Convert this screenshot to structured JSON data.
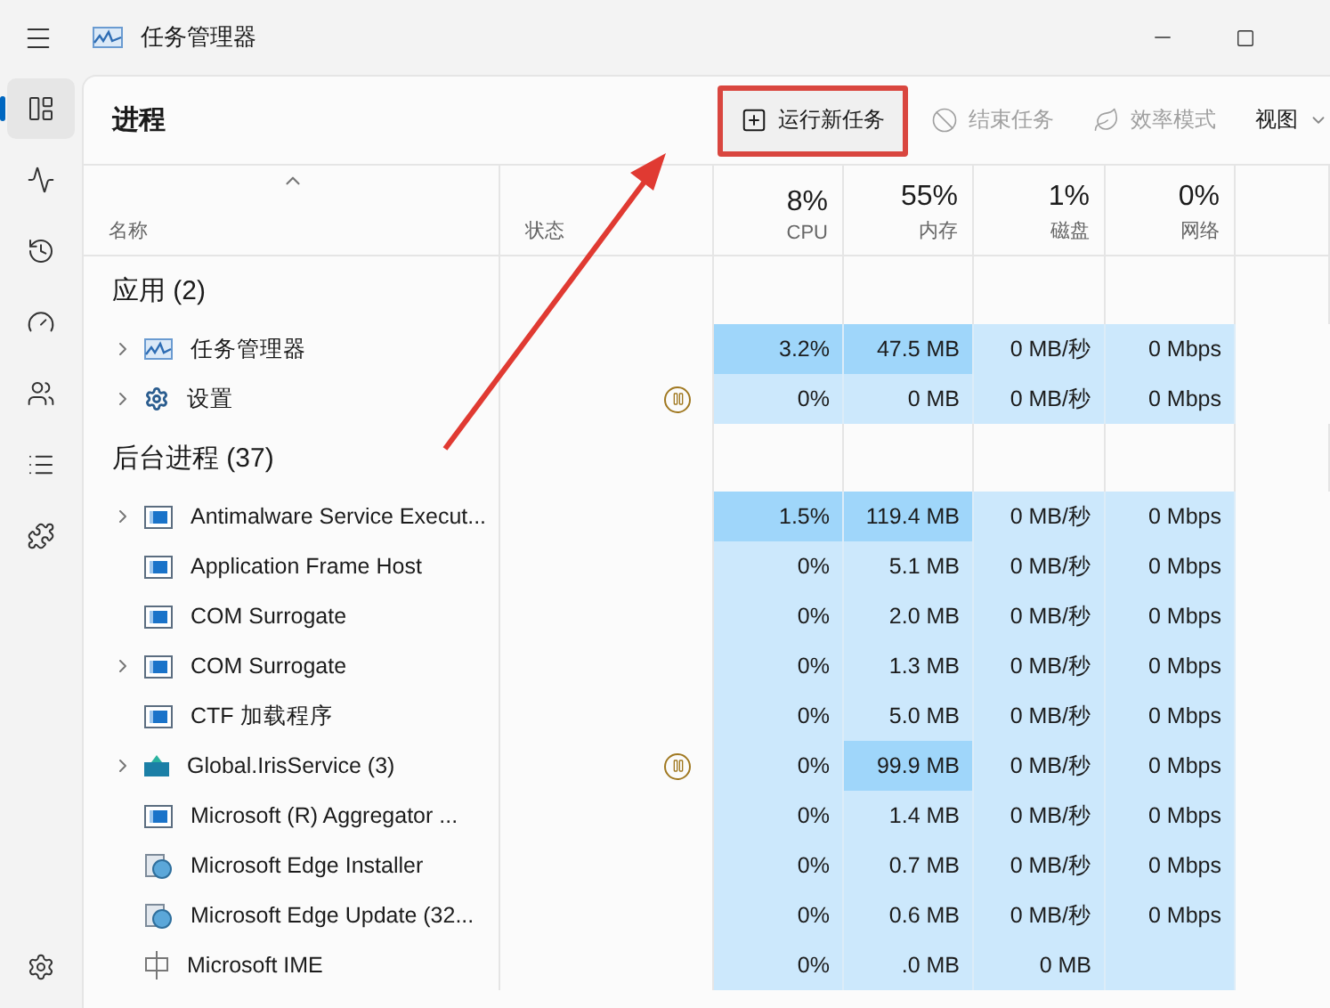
{
  "window": {
    "title": "任务管理器"
  },
  "nav": {
    "items": [
      {
        "kind": "processes",
        "selected": true
      },
      {
        "kind": "performance",
        "selected": false
      },
      {
        "kind": "history",
        "selected": false
      },
      {
        "kind": "startup",
        "selected": false
      },
      {
        "kind": "users",
        "selected": false
      },
      {
        "kind": "details",
        "selected": false
      },
      {
        "kind": "services",
        "selected": false
      }
    ],
    "footer": {
      "kind": "settings",
      "selected": false
    }
  },
  "page_title": "进程",
  "toolbar": [
    {
      "label": "运行新任务",
      "kind": "run",
      "disabled": false,
      "highlighted": true
    },
    {
      "label": "结束任务",
      "kind": "end",
      "disabled": true,
      "highlighted": false
    },
    {
      "label": "效率模式",
      "kind": "leaf",
      "disabled": true,
      "highlighted": false
    },
    {
      "label": "视图",
      "kind": "caret",
      "disabled": false,
      "highlighted": false
    }
  ],
  "pointer_arrow": true,
  "table": {
    "columns": [
      {
        "label": "名称",
        "sorted": true
      },
      {
        "label": "状态",
        "sorted": false
      },
      {
        "total": "8%",
        "label": "CPU",
        "sorted": false
      },
      {
        "total": "55%",
        "label": "内存",
        "sorted": false
      },
      {
        "total": "1%",
        "label": "磁盘",
        "sorted": false
      },
      {
        "total": "0%",
        "label": "网络",
        "sorted": false
      }
    ],
    "groups": [
      {
        "title": "应用 (2)",
        "rows": [
          {
            "name": "任务管理器",
            "kind": "taskmgr",
            "expandable": true,
            "suspended": false,
            "cpu": {
              "text": "3.2%",
              "hot": true
            },
            "memory": {
              "text": "47.5 MB",
              "hot": true
            },
            "disk": {
              "text": "0 MB/秒",
              "hot": false
            },
            "network": {
              "text": "0 Mbps",
              "hot": false
            }
          },
          {
            "name": "设置",
            "kind": "settings",
            "expandable": true,
            "suspended": true,
            "cpu": {
              "text": "0%",
              "hot": false
            },
            "memory": {
              "text": "0 MB",
              "hot": false
            },
            "disk": {
              "text": "0 MB/秒",
              "hot": false
            },
            "network": {
              "text": "0 Mbps",
              "hot": false
            }
          }
        ]
      },
      {
        "title": "后台进程 (37)",
        "rows": [
          {
            "name": "Antimalware Service Execut...",
            "kind": "window",
            "expandable": true,
            "suspended": false,
            "cpu": {
              "text": "1.5%",
              "hot": true
            },
            "memory": {
              "text": "119.4 MB",
              "hot": true
            },
            "disk": {
              "text": "0 MB/秒",
              "hot": false
            },
            "network": {
              "text": "0 Mbps",
              "hot": false
            }
          },
          {
            "name": "Application Frame Host",
            "kind": "window",
            "expandable": false,
            "suspended": false,
            "cpu": {
              "text": "0%",
              "hot": false
            },
            "memory": {
              "text": "5.1 MB",
              "hot": false
            },
            "disk": {
              "text": "0 MB/秒",
              "hot": false
            },
            "network": {
              "text": "0 Mbps",
              "hot": false
            }
          },
          {
            "name": "COM Surrogate",
            "kind": "window",
            "expandable": false,
            "suspended": false,
            "cpu": {
              "text": "0%",
              "hot": false
            },
            "memory": {
              "text": "2.0 MB",
              "hot": false
            },
            "disk": {
              "text": "0 MB/秒",
              "hot": false
            },
            "network": {
              "text": "0 Mbps",
              "hot": false
            }
          },
          {
            "name": "COM Surrogate",
            "kind": "window",
            "expandable": true,
            "suspended": false,
            "cpu": {
              "text": "0%",
              "hot": false
            },
            "memory": {
              "text": "1.3 MB",
              "hot": false
            },
            "disk": {
              "text": "0 MB/秒",
              "hot": false
            },
            "network": {
              "text": "0 Mbps",
              "hot": false
            }
          },
          {
            "name": "CTF 加载程序",
            "kind": "window",
            "expandable": false,
            "suspended": false,
            "cpu": {
              "text": "0%",
              "hot": false
            },
            "memory": {
              "text": "5.0 MB",
              "hot": false
            },
            "disk": {
              "text": "0 MB/秒",
              "hot": false
            },
            "network": {
              "text": "0 Mbps",
              "hot": false
            }
          },
          {
            "name": "Global.IrisService (3)",
            "kind": "iris",
            "expandable": true,
            "suspended": true,
            "cpu": {
              "text": "0%",
              "hot": false
            },
            "memory": {
              "text": "99.9 MB",
              "hot": true
            },
            "disk": {
              "text": "0 MB/秒",
              "hot": false
            },
            "network": {
              "text": "0 Mbps",
              "hot": false
            }
          },
          {
            "name": "Microsoft (R) Aggregator ...",
            "kind": "window",
            "expandable": false,
            "suspended": false,
            "cpu": {
              "text": "0%",
              "hot": false
            },
            "memory": {
              "text": "1.4 MB",
              "hot": false
            },
            "disk": {
              "text": "0 MB/秒",
              "hot": false
            },
            "network": {
              "text": "0 Mbps",
              "hot": false
            }
          },
          {
            "name": "Microsoft Edge Installer",
            "kind": "installer",
            "expandable": false,
            "suspended": false,
            "cpu": {
              "text": "0%",
              "hot": false
            },
            "memory": {
              "text": "0.7 MB",
              "hot": false
            },
            "disk": {
              "text": "0 MB/秒",
              "hot": false
            },
            "network": {
              "text": "0 Mbps",
              "hot": false
            }
          },
          {
            "name": "Microsoft Edge Update (32...",
            "kind": "installer",
            "expandable": false,
            "suspended": false,
            "cpu": {
              "text": "0%",
              "hot": false
            },
            "memory": {
              "text": "0.6 MB",
              "hot": false
            },
            "disk": {
              "text": "0 MB/秒",
              "hot": false
            },
            "network": {
              "text": "0 Mbps",
              "hot": false
            }
          },
          {
            "name": "Microsoft IME",
            "kind": "ime",
            "expandable": false,
            "suspended": false,
            "cpu": {
              "text": "0%",
              "hot": false
            },
            "memory": {
              "text": ".0 MB",
              "hot": false
            },
            "disk": {
              "text": "0 MB",
              "hot": false
            }
          }
        ]
      }
    ]
  }
}
